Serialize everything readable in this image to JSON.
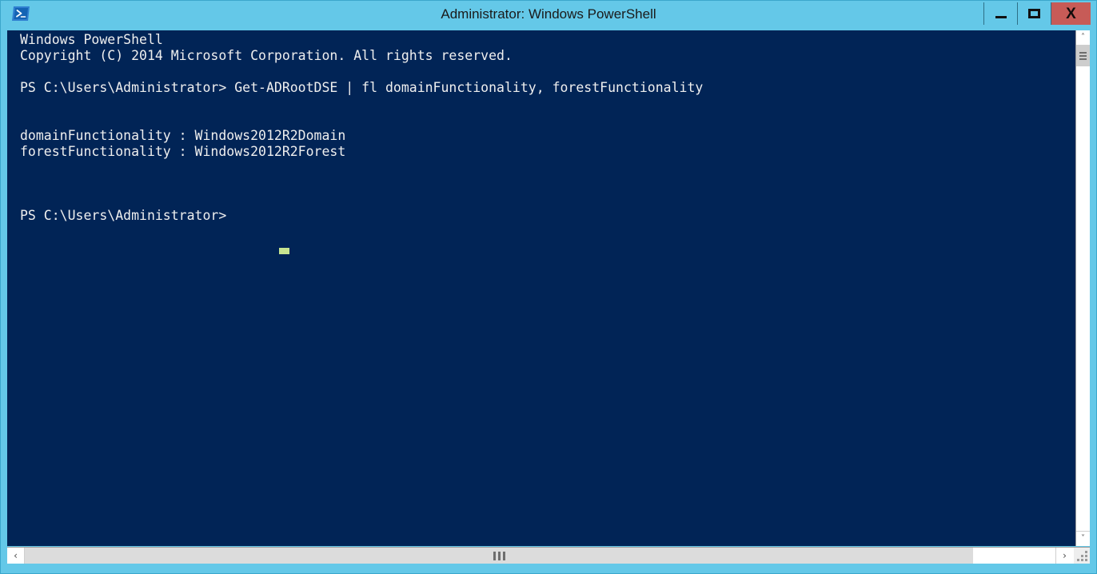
{
  "window": {
    "title": "Administrator: Windows PowerShell",
    "icon": "powershell-icon",
    "colors": {
      "titlebar": "#64c8e8",
      "console_background": "#012456",
      "console_foreground": "#efefef",
      "close_button": "#c75b57",
      "cursor": "#c7e490"
    },
    "controls": {
      "minimize_label": "—",
      "maximize_label": "□",
      "close_label": "X"
    }
  },
  "console": {
    "lines": [
      "Windows PowerShell",
      "Copyright (C) 2014 Microsoft Corporation. All rights reserved.",
      "",
      "PS C:\\Users\\Administrator> Get-ADRootDSE | fl domainFunctionality, forestFunctionality",
      "",
      "",
      "domainFunctionality : Windows2012R2Domain",
      "forestFunctionality : Windows2012R2Forest",
      "",
      "",
      "",
      "PS C:\\Users\\Administrator> "
    ],
    "text": "Windows PowerShell\nCopyright (C) 2014 Microsoft Corporation. All rights reserved.\n\nPS C:\\Users\\Administrator> Get-ADRootDSE | fl domainFunctionality, forestFunctionality\n\n\ndomainFunctionality : Windows2012R2Domain\nforestFunctionality : Windows2012R2Forest\n\n\n\nPS C:\\Users\\Administrator> ",
    "prompt": "PS C:\\Users\\Administrator>",
    "command": "Get-ADRootDSE | fl domainFunctionality, forestFunctionality",
    "results": [
      {
        "property": "domainFunctionality",
        "value": "Windows2012R2Domain"
      },
      {
        "property": "forestFunctionality",
        "value": "Windows2012R2Forest"
      }
    ],
    "banner": {
      "product": "Windows PowerShell",
      "copyright": "Copyright (C) 2014 Microsoft Corporation. All rights reserved."
    }
  },
  "scrollbars": {
    "vertical": {
      "up_arrow": "˄",
      "down_arrow": "˅"
    },
    "horizontal": {
      "left_arrow": "‹",
      "right_arrow": "›"
    }
  }
}
